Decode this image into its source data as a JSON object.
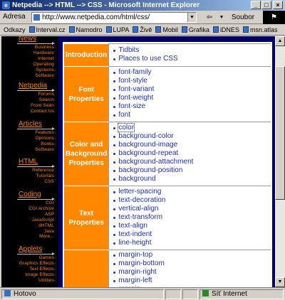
{
  "window": {
    "title": "Netpedia --> HTML --> CSS - Microsoft Internet Explorer"
  },
  "address": {
    "label": "Adresa",
    "url": "http://www.netpedia.com/html/css/",
    "back_label": "⇦",
    "go_label": "Soubor"
  },
  "links": {
    "label": "Odkazy",
    "items": [
      "Interval.cz",
      "Namodro",
      "LUPA",
      "Živě",
      "Mobil",
      "Grafika",
      "iDNES",
      "msn.atlas"
    ]
  },
  "sidebar": {
    "sections": [
      {
        "title": "News",
        "items": [
          "Business",
          "Hardware",
          "Internet",
          "Operating",
          "Systems",
          "Software"
        ]
      },
      {
        "title": "Netpedia",
        "items": [
          "Forums",
          "Search",
          "From Sean",
          "Contact Us"
        ]
      },
      {
        "title": "Articles",
        "items": [
          "Features",
          "Opinions",
          "Books",
          "Software"
        ]
      },
      {
        "title": "HTML",
        "items": [
          "Reference",
          "Tutorials",
          "CSS"
        ]
      },
      {
        "title": "Coding",
        "items": [
          "CGI",
          "CGI Archive",
          "ASP",
          "JavaScript",
          "dHTML",
          "Java",
          "More..."
        ]
      },
      {
        "title": "Applets",
        "items": [
          "Games",
          "Graphics Effects",
          "Text Effects",
          "Image Effects",
          "Utilities"
        ]
      }
    ]
  },
  "css_table": {
    "rows": [
      {
        "category": "Introduction",
        "items": [
          "Tidbits",
          "Places to use CSS"
        ]
      },
      {
        "category": "Font Properties",
        "items": [
          "font-family",
          "font-style",
          "font-variant",
          "font-weight",
          "font-size",
          "font"
        ]
      },
      {
        "category": "Color and Background Properties",
        "items": [
          "color",
          "background-color",
          "background-image",
          "background-repeat",
          "background-attachment",
          "background-position",
          "background"
        ]
      },
      {
        "category": "Text Properties",
        "items": [
          "letter-spacing",
          "text-decoration",
          "vertical-align",
          "text-transform",
          "text-align",
          "text-indent",
          "line-height"
        ]
      },
      {
        "category": "",
        "items": [
          "margin-top",
          "margin-bottom",
          "margin-right",
          "margin-left",
          "margin"
        ]
      }
    ]
  },
  "status": {
    "text": "Hotovo",
    "zone": "Síť Internet"
  }
}
